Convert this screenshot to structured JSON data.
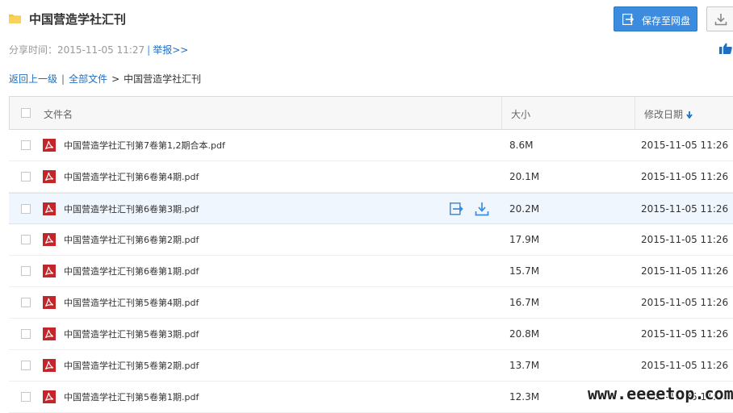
{
  "header": {
    "title": "中国营造学社汇刊",
    "save_button_label": "保存至网盘",
    "accent_color": "#3b8cde"
  },
  "share_info": {
    "share_time_label": "分享时间：",
    "share_time": "2015-11-05 11:27",
    "report_link": "举报>>"
  },
  "breadcrumb": {
    "back_link": "返回上一级",
    "all_files_link": "全部文件",
    "separator": ">",
    "current": "中国营造学社汇刊"
  },
  "table": {
    "columns": {
      "name": "文件名",
      "size": "大小",
      "date": "修改日期"
    },
    "rows": [
      {
        "name": "中国营造学社汇刊第7卷第1,2期合本.pdf",
        "size": "8.6M",
        "date": "2015-11-05 11:26"
      },
      {
        "name": "中国营造学社汇刊第6卷第4期.pdf",
        "size": "20.1M",
        "date": "2015-11-05 11:26"
      },
      {
        "name": "中国营造学社汇刊第6卷第3期.pdf",
        "size": "20.2M",
        "date": "2015-11-05 11:26"
      },
      {
        "name": "中国营造学社汇刊第6卷第2期.pdf",
        "size": "17.9M",
        "date": "2015-11-05 11:26"
      },
      {
        "name": "中国营造学社汇刊第6卷第1期.pdf",
        "size": "15.7M",
        "date": "2015-11-05 11:26"
      },
      {
        "name": "中国营造学社汇刊第5卷第4期.pdf",
        "size": "16.7M",
        "date": "2015-11-05 11:26"
      },
      {
        "name": "中国营造学社汇刊第5卷第3期.pdf",
        "size": "20.8M",
        "date": "2015-11-05 11:26"
      },
      {
        "name": "中国营造学社汇刊第5卷第2期.pdf",
        "size": "13.7M",
        "date": "2015-11-05 11:26"
      },
      {
        "name": "中国营造学社汇刊第5卷第1期.pdf",
        "size": "12.3M",
        "date": "2015-11-05 11:26"
      }
    ]
  },
  "watermark": "www.eeeetop.com"
}
